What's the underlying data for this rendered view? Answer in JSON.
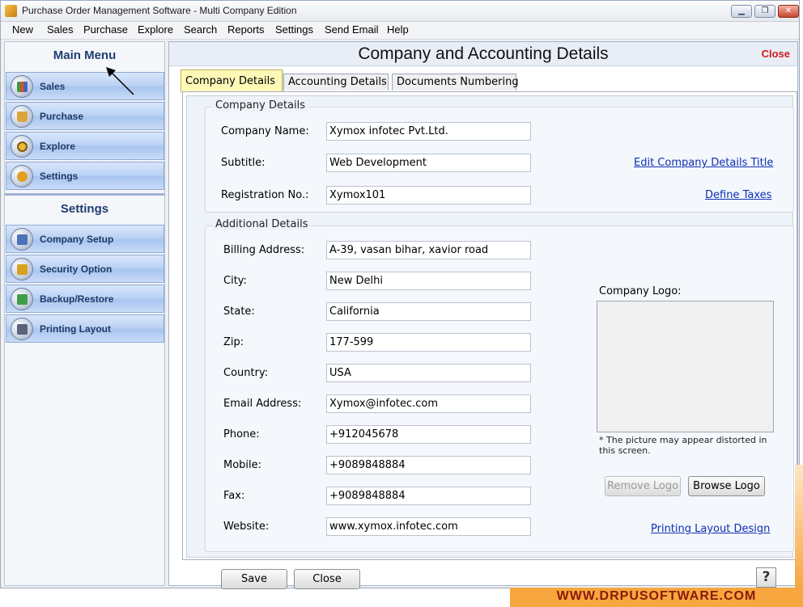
{
  "window": {
    "title": "Purchase Order Management Software - Multi Company Edition"
  },
  "menubar": [
    "New",
    "Sales",
    "Purchase",
    "Explore",
    "Search",
    "Reports",
    "Settings",
    "Send Email",
    "Help"
  ],
  "sidebar": {
    "main_menu_title": "Main Menu",
    "main_items": [
      {
        "label": "Sales",
        "icon": "chart-icon"
      },
      {
        "label": "Purchase",
        "icon": "basket-icon"
      },
      {
        "label": "Explore",
        "icon": "magnifier-icon"
      },
      {
        "label": "Settings",
        "icon": "gear-icon"
      }
    ],
    "settings_title": "Settings",
    "settings_items": [
      {
        "label": "Company Setup",
        "icon": "building-icon"
      },
      {
        "label": "Security Option",
        "icon": "lock-icon"
      },
      {
        "label": "Backup/Restore",
        "icon": "disk-icon"
      },
      {
        "label": "Printing Layout",
        "icon": "printer-icon"
      }
    ]
  },
  "content": {
    "title": "Company and Accounting Details",
    "close_label": "Close",
    "tabs": [
      "Company Details",
      "Accounting Details",
      "Documents Numbering"
    ],
    "company_group": {
      "title": "Company Details",
      "fields": [
        {
          "label": "Company Name:",
          "value": "Xymox infotec Pvt.Ltd."
        },
        {
          "label": "Subtitle:",
          "value": "Web Development"
        },
        {
          "label": "Registration No.:",
          "value": "Xymox101"
        }
      ],
      "edit_title_link": "Edit Company Details Title",
      "define_taxes_link": "Define Taxes"
    },
    "additional_group": {
      "title": "Additional Details",
      "fields": [
        {
          "label": "Billing Address:",
          "value": "A-39, vasan bihar, xavior road"
        },
        {
          "label": "City:",
          "value": "New Delhi"
        },
        {
          "label": "State:",
          "value": "California"
        },
        {
          "label": "Zip:",
          "value": "177-599"
        },
        {
          "label": "Country:",
          "value": "USA"
        },
        {
          "label": "Email Address:",
          "value": "Xymox@infotec.com"
        },
        {
          "label": "Phone:",
          "value": "+912045678"
        },
        {
          "label": "Mobile:",
          "value": "+9089848884"
        },
        {
          "label": "Fax:",
          "value": "+9089848884"
        },
        {
          "label": "Website:",
          "value": "www.xymox.infotec.com"
        }
      ],
      "logo_label": "Company Logo:",
      "logo_note": "* The picture may appear distorted in this screen.",
      "remove_logo": "Remove Logo",
      "browse_logo": "Browse Logo",
      "printing_layout_link": "Printing Layout Design"
    },
    "footer": {
      "save": "Save",
      "close": "Close",
      "help": "?"
    }
  },
  "brand": "WWW.DRPUSOFTWARE.COM"
}
